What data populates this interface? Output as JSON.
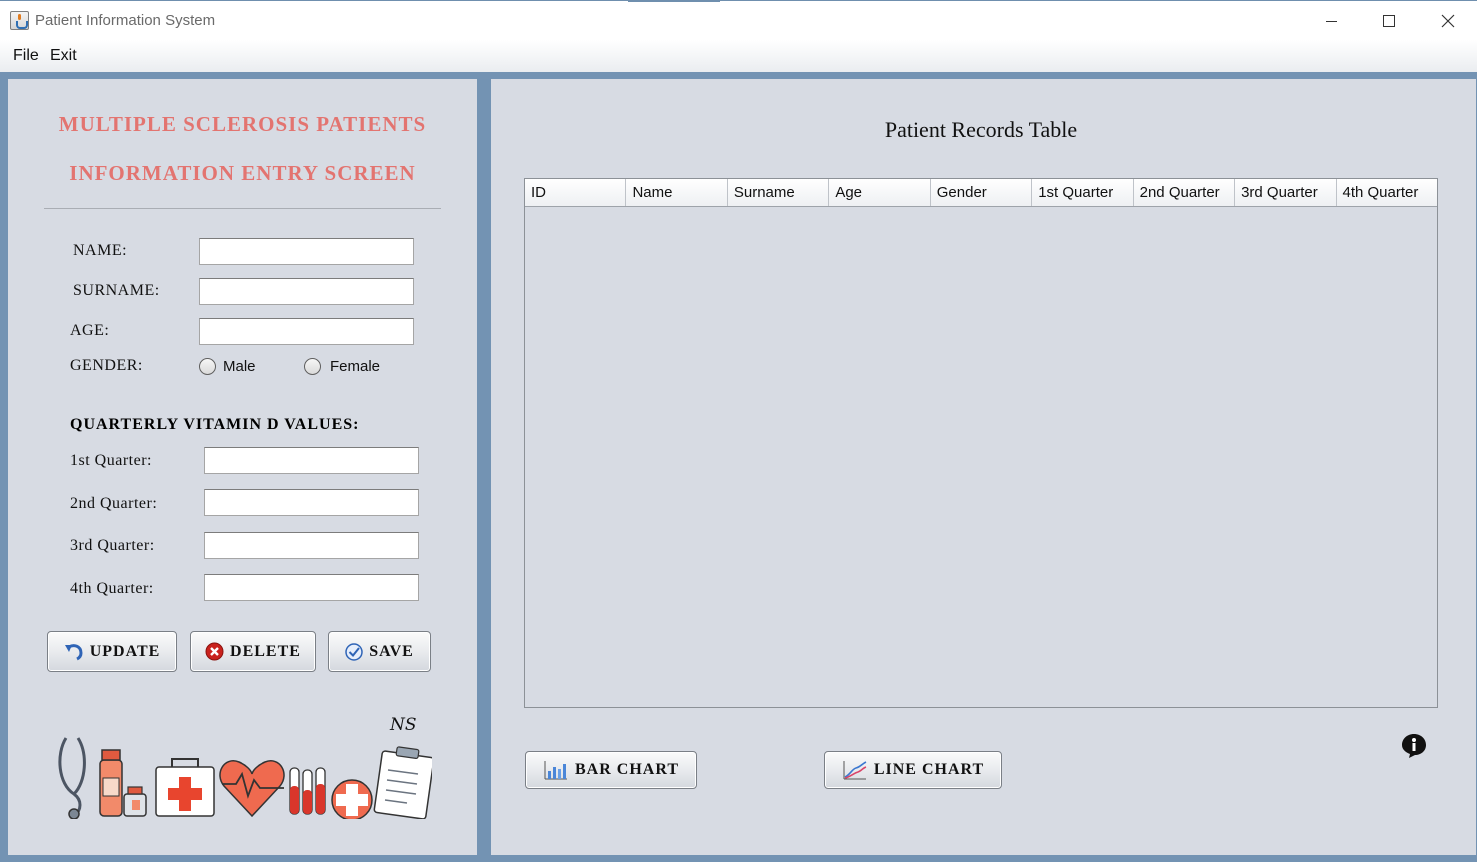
{
  "window": {
    "title": "Patient Information System",
    "minimize": "minimize",
    "maximize": "maximize",
    "close": "close"
  },
  "menu": {
    "file": "File",
    "exit": "Exit"
  },
  "entry_form": {
    "heading_line1": "MULTIPLE SCLEROSIS PATIENTS",
    "heading_line2": "INFORMATION ENTRY SCREEN",
    "name_label": "NAME:",
    "name_value": "",
    "surname_label": "SURNAME:",
    "surname_value": "",
    "age_label": "AGE:",
    "age_value": "",
    "gender_label": "GENDER:",
    "gender_options": [
      "Male",
      "Female"
    ],
    "gender_selected": "",
    "vitamin_title": "QUARTERLY VITAMIN D VALUES:",
    "q1_label": "1st Quarter:",
    "q1_value": "",
    "q2_label": "2nd Quarter:",
    "q2_value": "",
    "q3_label": "3rd Quarter:",
    "q3_value": "",
    "q4_label": "4th Quarter:",
    "q4_value": "",
    "update_label": "UPDATE",
    "delete_label": "DELETE",
    "save_label": "SAVE",
    "signature": "NS"
  },
  "records": {
    "title": "Patient Records Table",
    "columns": [
      "ID",
      "Name",
      "Surname",
      "Age",
      "Gender",
      "1st Quarter",
      "2nd Quarter",
      "3rd Quarter",
      "4th Quarter"
    ],
    "rows": [],
    "bar_chart_label": "BAR CHART",
    "line_chart_label": "LINE CHART"
  },
  "icons": {
    "app": "java-cup-icon",
    "update": "undo-arrow-icon",
    "delete": "red-x-circle-icon",
    "save": "blue-check-circle-icon",
    "bar_chart": "bar-chart-icon",
    "line_chart": "line-chart-icon",
    "info": "info-icon"
  },
  "colors": {
    "frame": "#7393b3",
    "panel": "#d7dbe3",
    "heading": "#e37470"
  }
}
